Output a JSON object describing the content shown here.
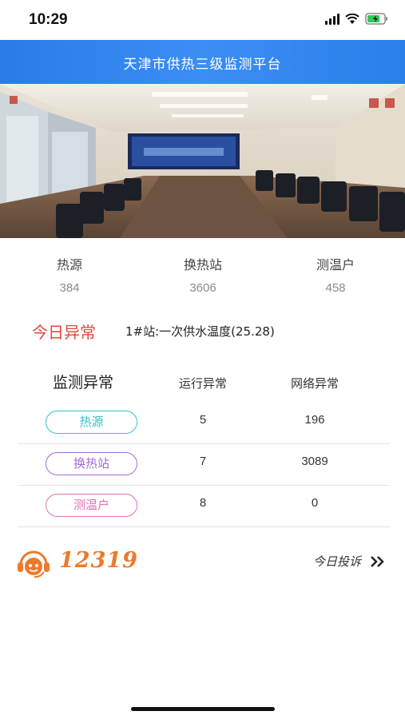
{
  "status_bar": {
    "time": "10:29"
  },
  "header": {
    "title": "天津市供热三级监测平台"
  },
  "banner": {
    "slides": 4,
    "active_slide": 2
  },
  "stats": [
    {
      "label": "热源",
      "value": "384"
    },
    {
      "label": "换热站",
      "value": "3606"
    },
    {
      "label": "测温户",
      "value": "458"
    }
  ],
  "today_anomaly": {
    "title": "今日异常",
    "text": "1#站:一次供水温度(25.28)"
  },
  "monitor": {
    "title": "监测异常",
    "col_run": "运行异常",
    "col_net": "网络异常",
    "rows": [
      {
        "label": "热源",
        "run": "5",
        "net": "196",
        "color": "#39c2c7"
      },
      {
        "label": "换热站",
        "run": "7",
        "net": "3089",
        "color": "#a36bd8"
      },
      {
        "label": "测温户",
        "run": "8",
        "net": "0",
        "color": "#e46fb0"
      }
    ]
  },
  "hotline": {
    "number": "12319",
    "complaint_label": "今日投诉",
    "accent": "#ec7a2c"
  }
}
